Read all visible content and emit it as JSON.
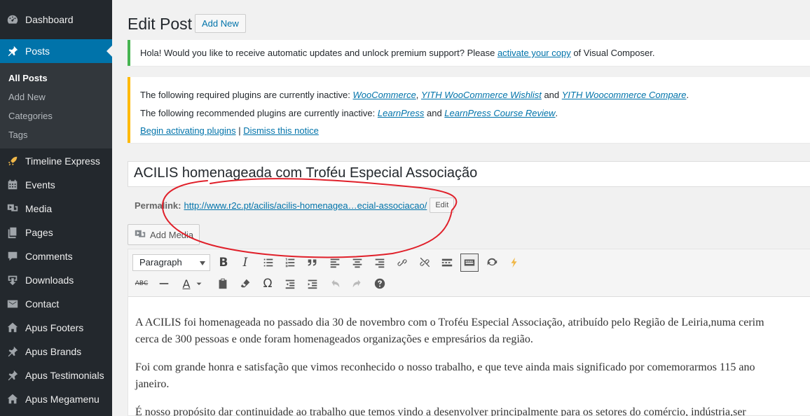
{
  "sidebar": {
    "items": [
      {
        "label": "Dashboard",
        "icon": "dashboard-icon"
      },
      {
        "label": "Posts",
        "icon": "pin-icon"
      },
      {
        "label": "Timeline Express",
        "icon": "rocket-icon"
      },
      {
        "label": "Events",
        "icon": "calendar-icon"
      },
      {
        "label": "Media",
        "icon": "media-icon"
      },
      {
        "label": "Pages",
        "icon": "pages-icon"
      },
      {
        "label": "Comments",
        "icon": "comment-icon"
      },
      {
        "label": "Downloads",
        "icon": "download-icon"
      },
      {
        "label": "Contact",
        "icon": "mail-icon"
      },
      {
        "label": "Apus Footers",
        "icon": "home-icon"
      },
      {
        "label": "Apus Brands",
        "icon": "pin-icon"
      },
      {
        "label": "Apus Testimonials",
        "icon": "pin-icon"
      },
      {
        "label": "Apus Megamenu",
        "icon": "home-icon"
      }
    ],
    "submenu": [
      "All Posts",
      "Add New",
      "Categories",
      "Tags"
    ]
  },
  "header": {
    "title": "Edit Post",
    "add_new": "Add New"
  },
  "notice_vc": {
    "text_before": "Hola! Would you like to receive automatic updates and unlock premium support? Please ",
    "link": "activate your copy",
    "text_after": " of Visual Composer."
  },
  "notice_tgm": {
    "req_prefix": "The following required plugins are currently inactive: ",
    "req_plugin_1": "WooCommerce",
    "req_sep": ", ",
    "req_plugin_2": "YITH WooCommerce Wishlist",
    "req_and": " and ",
    "req_plugin_3": "YITH Woocommerce Compare",
    "req_end": ".",
    "rec_prefix": "The following recommended plugins are currently inactive: ",
    "rec_plugin_1": "LearnPress",
    "rec_and": " and ",
    "rec_plugin_2": "LearnPress Course Review",
    "rec_end": ".",
    "begin": "Begin activating plugins",
    "sep": " | ",
    "dismiss": "Dismiss this notice"
  },
  "post": {
    "title": "ACILIS homenageada com Troféu Especial Associação",
    "permalink_label": "Permalink:",
    "permalink_base": "http://www.r2c.pt/acilis/",
    "permalink_slug": "acilis-homenagea…ecial-associacao/",
    "edit_label": "Edit"
  },
  "editor": {
    "add_media": "Add Media",
    "format": "Paragraph",
    "paragraphs": [
      "A ACILIS foi homenageada no passado dia 30 de novembro com o Troféu Especial Associação, atribuído pelo Região de Leiria,numa cerim",
      "cerca de 300 pessoas e onde foram homenageados organizações e empresários da região.",
      "Foi com grande honra e satisfação que vimos reconhecido o nosso trabalho, e que teve ainda mais significado por comemorarmos 115 ano",
      "janeiro.",
      "É nosso propósito dar continuidade ao trabalho que temos vindo a desenvolver principalmente para os setores do comércio, indústria,ser"
    ]
  },
  "colors": {
    "accent": "#0073aa",
    "sidebar": "#23282d",
    "annotation": "#e0202a"
  }
}
